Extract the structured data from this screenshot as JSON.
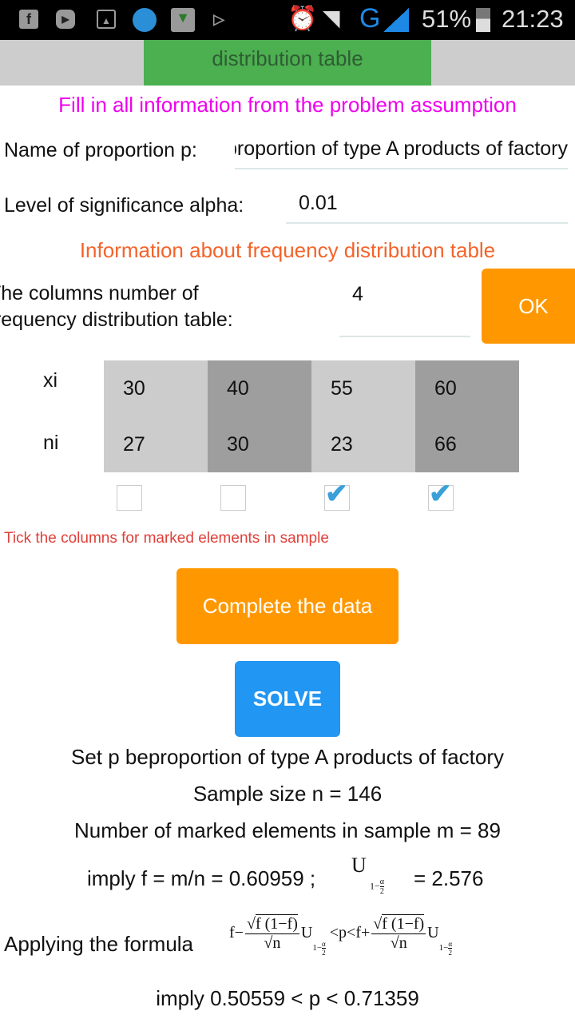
{
  "status_bar": {
    "battery": "51%",
    "time": "21:23",
    "network": "G",
    "icons": [
      "facebook-icon",
      "youtube-icon",
      "gallery-icon",
      "camera-aperture-icon",
      "shield-icon",
      "play-store-icon",
      "alarm-icon",
      "wifi-icon",
      "signal-icon",
      "battery-icon"
    ]
  },
  "top_button": {
    "label": "distribution table"
  },
  "header_instruction": "Fill in all information from the problem assumption",
  "proportion": {
    "label": "Name of proportion p:",
    "value": "proportion of type A products of factory"
  },
  "alpha": {
    "label": "Level of significance alpha:",
    "value": "0.01"
  },
  "freq_header": "Information about frequency distribution table",
  "columns": {
    "label_line1": "The columns number of",
    "label_line2": "frequency distribution table:",
    "value": "4",
    "ok_label": "OK"
  },
  "table": {
    "xi_label": "xi",
    "ni_label": "ni",
    "xi": [
      "30",
      "40",
      "55",
      "60"
    ],
    "ni": [
      "27",
      "30",
      "23",
      "66"
    ],
    "checked": [
      false,
      false,
      true,
      true
    ]
  },
  "tick_hint": "Tick the columns for marked elements in sample",
  "complete_label": "Complete the data",
  "solve_label": "SOLVE",
  "results": {
    "line1": "Set p beproportion of type A products of factory",
    "line2": "Sample size n = 146",
    "line3": "Number of marked elements in sample m = 89",
    "line4a": "imply f = m/n = 0.60959 ;",
    "line4b": "= 2.576",
    "formula_label": "Applying the formula",
    "line6": "imply 0.50559  < p < 0.71359"
  },
  "formula": {
    "f": "f",
    "minus": "−",
    "plus": "+",
    "num": "f (1−f)",
    "den": "n",
    "U": "U",
    "sub": "1−",
    "alpha": "α",
    "two": "2",
    "lt_p_lt": "<p<"
  },
  "colors": {
    "green": "#4caf50",
    "orange": "#ff9800",
    "blue": "#2196f3",
    "magenta": "#ee00ee",
    "orange_text": "#f4632a",
    "hint_red": "#e0403a",
    "cell_light": "#cccccc",
    "cell_dark": "#9e9e9e"
  }
}
